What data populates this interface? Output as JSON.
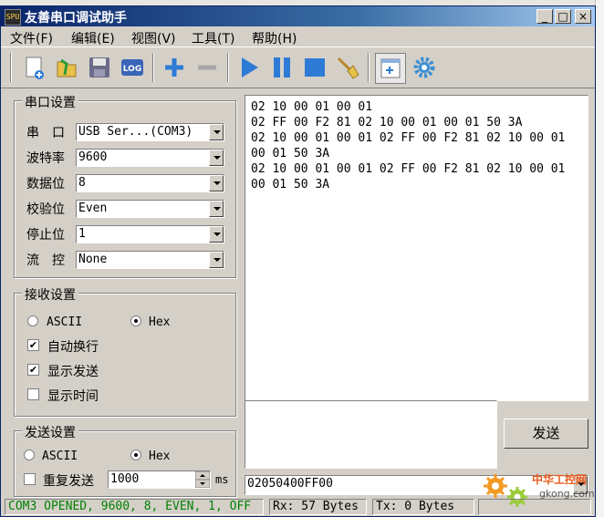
{
  "window": {
    "title": "友善串口调试助手",
    "icon_text": "SPU"
  },
  "title_buttons": {
    "minimize": "_",
    "maximize": "□",
    "close": "×"
  },
  "menu": [
    {
      "label": "文件(F)"
    },
    {
      "label": "编辑(E)"
    },
    {
      "label": "视图(V)"
    },
    {
      "label": "工具(T)"
    },
    {
      "label": "帮助(H)"
    }
  ],
  "toolbar": {
    "icons": [
      "new-file-icon",
      "open-file-icon",
      "save-icon",
      "log-icon",
      "plus-icon",
      "minus-icon",
      "play-icon",
      "pause-icon",
      "stop-icon",
      "clear-broom-icon",
      "new-window-icon",
      "settings-gear-icon"
    ],
    "log_text": "LOG"
  },
  "serial_settings": {
    "title": "串口设置",
    "fields": [
      {
        "label": "串　口",
        "value": "USB Ser...(COM3)"
      },
      {
        "label": "波特率",
        "value": "9600"
      },
      {
        "label": "数据位",
        "value": "8"
      },
      {
        "label": "校验位",
        "value": "Even"
      },
      {
        "label": "停止位",
        "value": "1"
      },
      {
        "label": "流　控",
        "value": "None"
      }
    ]
  },
  "receive_settings": {
    "title": "接收设置",
    "ascii_label": "ASCII",
    "hex_label": "Hex",
    "mode": "Hex",
    "auto_wrap_label": "自动换行",
    "auto_wrap": true,
    "show_send_label": "显示发送",
    "show_send": true,
    "show_time_label": "显示时间",
    "show_time": false
  },
  "send_settings": {
    "title": "发送设置",
    "ascii_label": "ASCII",
    "hex_label": "Hex",
    "mode": "Hex",
    "repeat_label": "重复发送",
    "repeat": false,
    "interval_value": "1000",
    "interval_unit": "ms"
  },
  "receive_area": {
    "lines": [
      "02 10 00 01 00 01",
      "02 FF 00 F2 81 02 10 00 01 00 01 50 3A",
      "02 10 00 01 00 01 02 FF 00 F2 81 02 10 00 01",
      "00 01 50 3A",
      "02 10 00 01 00 01 02 FF 00 F2 81 02 10 00 01",
      "00 01 50 3A"
    ]
  },
  "send_area": {
    "text": "",
    "button_label": "发送"
  },
  "send_history": {
    "value": "02050400FF00"
  },
  "status_bar": {
    "port_status": "COM3 OPENED, 9600, 8, EVEN, 1, OFF",
    "rx": "Rx: 57 Bytes",
    "tx": "Tx: 0 Bytes",
    "status_color": "#008000"
  },
  "watermark": {
    "text": "中华工控网",
    "url": "gkong.com"
  }
}
